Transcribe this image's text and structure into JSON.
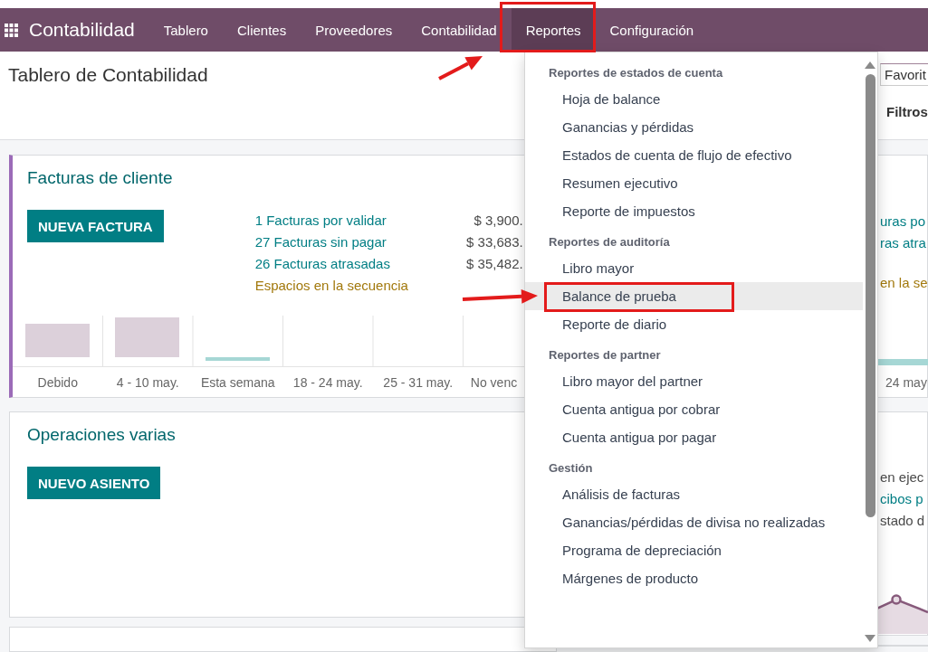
{
  "app": {
    "name": "Contabilidad"
  },
  "nav": [
    {
      "label": "Tablero",
      "selected": false
    },
    {
      "label": "Clientes",
      "selected": false
    },
    {
      "label": "Proveedores",
      "selected": false
    },
    {
      "label": "Contabilidad",
      "selected": false
    },
    {
      "label": "Reportes",
      "selected": true
    },
    {
      "label": "Configuración",
      "selected": false
    }
  ],
  "page_title": "Tablero de Contabilidad",
  "favorites_toggle": "Favorit",
  "filters_toggle": "Filtros",
  "cards": [
    {
      "kind": "invoices",
      "title": "Facturas de cliente",
      "button": "NUEVA FACTURA",
      "stats": [
        {
          "label": "1 Facturas por validar",
          "amount": "$ 3,900.",
          "kind": "link"
        },
        {
          "label": "27 Facturas sin pagar",
          "amount": "$ 33,683.",
          "kind": "link"
        },
        {
          "label": "26 Facturas atrasadas",
          "amount": "$ 35,482.",
          "kind": "link"
        },
        {
          "label": "Espacios en la secuencia",
          "kind": "warning"
        }
      ],
      "chart_labels": [
        "Debido",
        "4 - 10 may.",
        "Esta semana",
        "18 - 24 may.",
        "25 - 31 may.",
        "No venc"
      ]
    },
    {
      "kind": "journal",
      "title": "Operaciones varias",
      "button": "NUEVO ASIENTO"
    },
    {
      "kind": "blank"
    }
  ],
  "right_cards": [
    {
      "kind": "bars",
      "lines": [
        {
          "text": "uras po",
          "kind": "link"
        },
        {
          "text": "ras atra",
          "kind": "link"
        },
        {
          "text": "en la se",
          "kind": "warning"
        }
      ],
      "chart_label": "24 may"
    },
    {
      "kind": "line",
      "lines": [
        {
          "text": "en ejec",
          "kind": "muted"
        },
        {
          "text": "cibos p",
          "kind": "link"
        },
        {
          "text": "stado d",
          "kind": "muted"
        }
      ]
    },
    {
      "kind": "blank"
    }
  ],
  "reports_menu": {
    "sections": [
      {
        "heading": "Reportes de estados de cuenta",
        "items": [
          {
            "label": "Hoja de balance",
            "highlighted": false
          },
          {
            "label": "Ganancias y pérdidas",
            "highlighted": false
          },
          {
            "label": "Estados de cuenta de flujo de efectivo",
            "highlighted": false
          },
          {
            "label": "Resumen ejecutivo",
            "highlighted": false
          },
          {
            "label": "Reporte de impuestos",
            "highlighted": false
          }
        ]
      },
      {
        "heading": "Reportes de auditoría",
        "items": [
          {
            "label": "Libro mayor",
            "highlighted": false
          },
          {
            "label": "Balance de prueba",
            "highlighted": true
          },
          {
            "label": "Reporte de diario",
            "highlighted": false
          }
        ]
      },
      {
        "heading": "Reportes de partner",
        "items": [
          {
            "label": "Libro mayor del partner",
            "highlighted": false
          },
          {
            "label": "Cuenta antigua por cobrar",
            "highlighted": false
          },
          {
            "label": "Cuenta antigua por pagar",
            "highlighted": false
          }
        ]
      },
      {
        "heading": "Gestión",
        "items": [
          {
            "label": "Análisis de facturas",
            "highlighted": false
          },
          {
            "label": "Ganancias/pérdidas de divisa no realizadas",
            "highlighted": false
          },
          {
            "label": "Programa de depreciación",
            "highlighted": false
          },
          {
            "label": "Márgenes de producto",
            "highlighted": false
          }
        ]
      }
    ]
  }
}
